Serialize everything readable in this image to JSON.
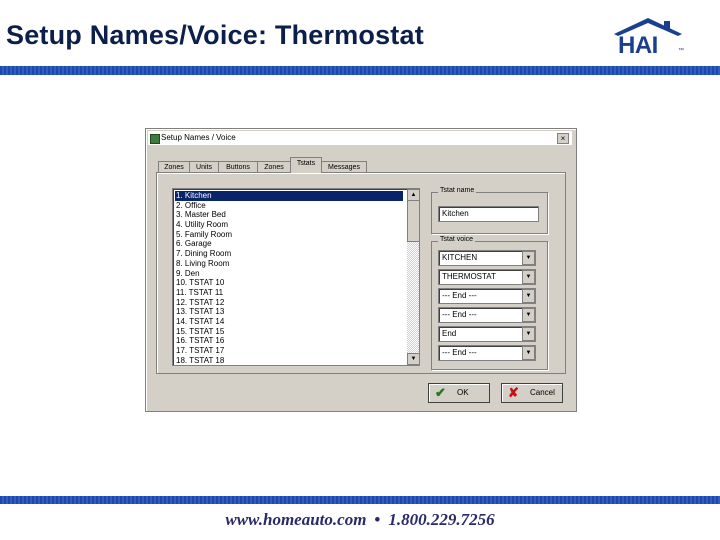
{
  "slide": {
    "title": "Setup Names/Voice: Thermostat",
    "logo_text": "HAI",
    "logo_tm": "™",
    "footer_url": "www.homeauto.com",
    "footer_sep": "•",
    "footer_phone": "1.800.229.7256"
  },
  "colors": {
    "title": "#0b1f4a",
    "bar": "#2f5ec4",
    "selection": "#0a246a"
  },
  "dialog": {
    "title": "Setup Names / Voice",
    "close": "×",
    "tabs": [
      "Zones",
      "Units",
      "Buttons",
      "Zones",
      "Tstats",
      "Messages"
    ],
    "active_tab": "Tstats",
    "list": [
      "1. Kitchen",
      "2. Office",
      "3. Master Bed",
      "4. Utility Room",
      "5. Family Room",
      "6. Garage",
      "7. Dining Room",
      "8. Living Room",
      "9. Den",
      "10. TSTAT 10",
      "11. TSTAT 11",
      "12. TSTAT 12",
      "13. TSTAT 13",
      "14. TSTAT 14",
      "15. TSTAT 15",
      "16. TSTAT 16",
      "17. TSTAT 17",
      "18. TSTAT 18"
    ],
    "selected_index": 0,
    "scroll_up": "▲",
    "scroll_down": "▼",
    "tstat_name_label": "Tstat name",
    "tstat_name_value": "Kitchen",
    "tstat_voice_label": "Tstat voice",
    "voice_slots": [
      "KITCHEN",
      "THERMOSTAT",
      "--- End ---",
      "--- End ---",
      "End",
      "--- End ---"
    ],
    "combo_arrow": "▼",
    "ok_label": "OK",
    "ok_icon": "✔",
    "cancel_label": "Cancel",
    "cancel_icon": "✘"
  }
}
